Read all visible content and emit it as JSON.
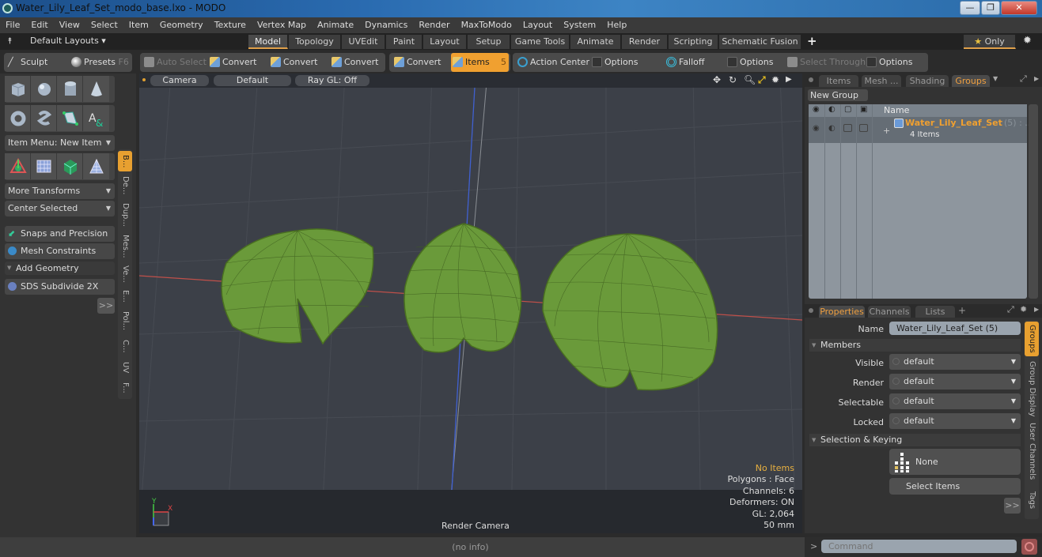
{
  "window": {
    "title": "Water_Lily_Leaf_Set_modo_base.lxo - MODO",
    "controls": [
      "minimize",
      "restore",
      "close"
    ]
  },
  "menu": [
    "File",
    "Edit",
    "View",
    "Select",
    "Item",
    "Geometry",
    "Texture",
    "Vertex Map",
    "Animate",
    "Dynamics",
    "Render",
    "MaxToModo",
    "Layout",
    "System",
    "Help"
  ],
  "layout_bar": {
    "layouts_label": "Default Layouts ▾",
    "tabs": [
      "Model",
      "Topology",
      "UVEdit",
      "Paint",
      "Layout",
      "Setup",
      "Game Tools",
      "Animate",
      "Render",
      "Scripting",
      "Schematic Fusion"
    ],
    "active_tab": "Model",
    "add": "+",
    "only_label": "Only"
  },
  "toolbar": {
    "sculpt": "Sculpt",
    "presets": "Presets",
    "presets_key": "F6",
    "auto_select": "Auto Select",
    "convert1": "Convert",
    "convert2": "Convert",
    "convert3": "Convert",
    "convert4": "Convert",
    "items": "Items",
    "items_key": "5",
    "action_center": "Action Center",
    "options1": "Options",
    "falloff": "Falloff",
    "options2": "Options",
    "select_through": "Select Through",
    "options3": "Options"
  },
  "left_panel": {
    "item_menu": "Item Menu: New Item",
    "more_transforms": "More Transforms",
    "center_selected": "Center Selected",
    "snaps": "Snaps and Precision",
    "mesh_constraints": "Mesh Constraints",
    "add_geometry": "Add Geometry",
    "sds": "SDS Subdivide 2X",
    "more": ">>",
    "vtabs": [
      "B...",
      "De...",
      "Dup...",
      "Mes...",
      "Ve...",
      "E...",
      "Pol...",
      "C...",
      "UV",
      "F..."
    ]
  },
  "viewport": {
    "camera": "Camera",
    "shading": "Default",
    "raygl": "Ray GL: Off",
    "render_camera": "Render Camera",
    "axis_y": "Y",
    "axis_x": "X",
    "info": {
      "selection": "No Items",
      "polygons": "Polygons : Face",
      "channels": "Channels: 6",
      "deformers": "Deformers: ON",
      "gl": "GL: 2,064",
      "lens": "50 mm"
    },
    "colors": {
      "leaf": "#6a9a3a",
      "selection_text": "#e8b040"
    }
  },
  "groups_panel": {
    "tabs": [
      "Items",
      "Mesh ...",
      "Shading",
      "Groups"
    ],
    "active_tab": "Groups",
    "new_group": "New Group",
    "name_header": "Name",
    "row": {
      "name": "Water_Lily_Leaf_Set",
      "count": "(5) : ...",
      "sub": "4 Items"
    }
  },
  "properties_panel": {
    "tabs": [
      "Properties",
      "Channels",
      "Lists"
    ],
    "active_tab": "Properties",
    "name_label": "Name",
    "name_value": "Water_Lily_Leaf_Set (5)",
    "members_section": "Members",
    "fields": [
      {
        "label": "Visible",
        "value": "default"
      },
      {
        "label": "Render",
        "value": "default"
      },
      {
        "label": "Selectable",
        "value": "default"
      },
      {
        "label": "Locked",
        "value": "default"
      }
    ],
    "selection_section": "Selection & Keying",
    "none_label": "None",
    "select_items": "Select Items",
    "more": ">>",
    "side_tabs": [
      "Groups",
      "Group Display",
      "User Channels",
      "Tags"
    ]
  },
  "status": {
    "info": "(no info)",
    "command_placeholder": "Command",
    "prompt": ">"
  }
}
